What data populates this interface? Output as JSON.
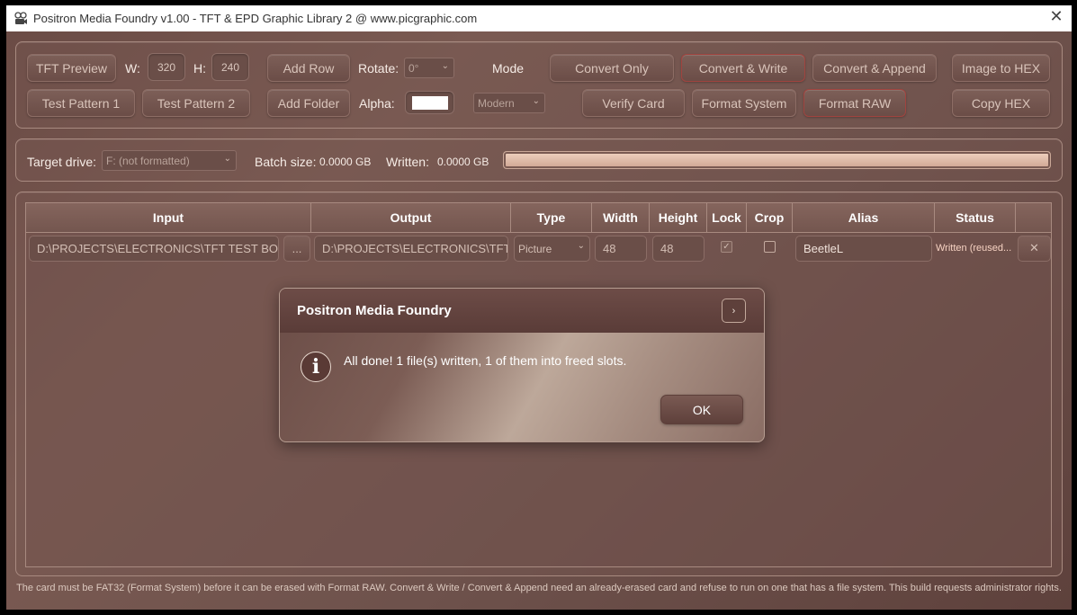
{
  "window": {
    "title": "Positron Media Foundry v1.00 - TFT & EPD Graphic Library 2 @ www.picgraphic.com",
    "close_glyph": "✕"
  },
  "toolbar": {
    "tft_preview": "TFT Preview",
    "w_label": "W:",
    "w_value": "320",
    "h_label": "H:",
    "h_value": "240",
    "add_row": "Add Row",
    "rotate_label": "Rotate:",
    "rotate_value": "0°",
    "mode_label": "Mode",
    "convert_only": "Convert Only",
    "convert_write": "Convert & Write",
    "convert_append": "Convert & Append",
    "image_to_hex": "Image to HEX",
    "test_pattern_1": "Test Pattern 1",
    "test_pattern_2": "Test Pattern 2",
    "add_folder": "Add Folder",
    "alpha_label": "Alpha:",
    "alpha_color": "#ffffff",
    "mode_value": "Modern",
    "verify_card": "Verify Card",
    "format_system": "Format System",
    "format_raw": "Format RAW",
    "copy_hex": "Copy HEX"
  },
  "drive": {
    "target_label": "Target drive:",
    "target_value": "F: (not formatted)",
    "batch_label": "Batch size:",
    "batch_value": "0.0000 GB",
    "written_label": "Written:",
    "written_value": "0.0000 GB",
    "progress": 1.0
  },
  "grid": {
    "columns": [
      "Input",
      "Output",
      "Type",
      "Width",
      "Height",
      "Lock",
      "Crop",
      "Alias",
      "Status"
    ],
    "rows": [
      {
        "input": "D:\\PROJECTS\\ELECTRONICS\\TFT TEST BOARD\\",
        "browse": "...",
        "output": "D:\\PROJECTS\\ELECTRONICS\\TFT TE",
        "type": "Picture",
        "width": "48",
        "height": "48",
        "lock": true,
        "crop": false,
        "alias": "BeetleL",
        "status": "Written (reused...",
        "remove": "✕"
      }
    ]
  },
  "dialog": {
    "title": "Positron Media Foundry",
    "minimize_glyph": "›",
    "icon_glyph": "i",
    "message": "All done! 1 file(s) written, 1 of them into freed slots.",
    "ok": "OK"
  },
  "footer": "The card must be FAT32 (Format System) before it can be erased with Format RAW. Convert & Write / Convert & Append need an already-erased card and refuse to run on one that has a file system. This build requests administrator rights.",
  "colors": {
    "background": "#6e524c",
    "accent_border": "#a0443f",
    "progress_fill": "#e8c4b2"
  }
}
